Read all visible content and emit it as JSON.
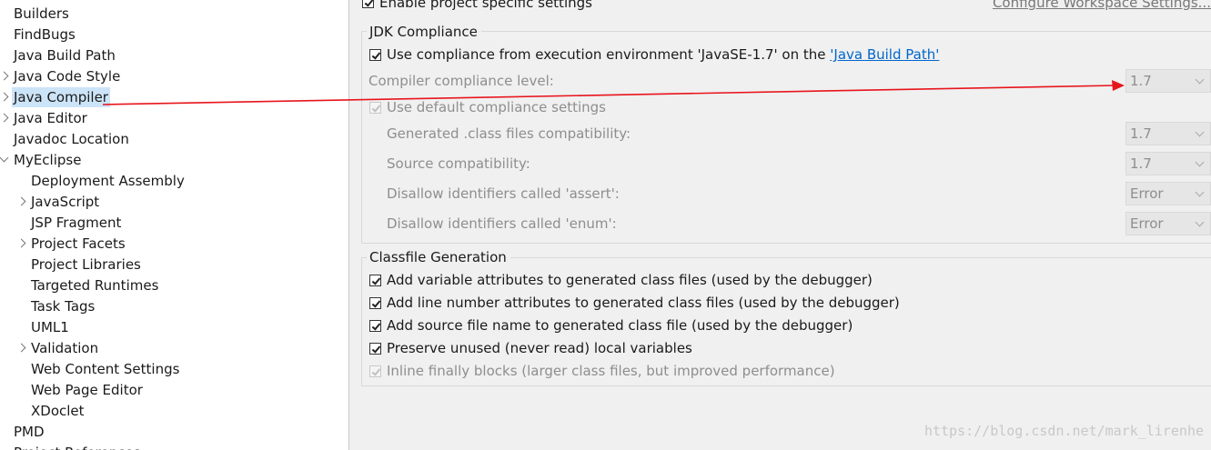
{
  "tree": [
    {
      "label": "Builders",
      "indent": 0,
      "expander": "none"
    },
    {
      "label": "FindBugs",
      "indent": 0,
      "expander": "none"
    },
    {
      "label": "Java Build Path",
      "indent": 0,
      "expander": "none"
    },
    {
      "label": "Java Code Style",
      "indent": 0,
      "expander": "collapsed"
    },
    {
      "label": "Java Compiler",
      "indent": 0,
      "expander": "collapsed",
      "selected": true
    },
    {
      "label": "Java Editor",
      "indent": 0,
      "expander": "collapsed"
    },
    {
      "label": "Javadoc Location",
      "indent": 0,
      "expander": "none"
    },
    {
      "label": "MyEclipse",
      "indent": 0,
      "expander": "expanded"
    },
    {
      "label": "Deployment Assembly",
      "indent": 1,
      "expander": "none"
    },
    {
      "label": "JavaScript",
      "indent": 1,
      "expander": "collapsed"
    },
    {
      "label": "JSP Fragment",
      "indent": 1,
      "expander": "none"
    },
    {
      "label": "Project Facets",
      "indent": 1,
      "expander": "collapsed"
    },
    {
      "label": "Project Libraries",
      "indent": 1,
      "expander": "none"
    },
    {
      "label": "Targeted Runtimes",
      "indent": 1,
      "expander": "none"
    },
    {
      "label": "Task Tags",
      "indent": 1,
      "expander": "none"
    },
    {
      "label": "UML1",
      "indent": 1,
      "expander": "none"
    },
    {
      "label": "Validation",
      "indent": 1,
      "expander": "collapsed"
    },
    {
      "label": "Web Content Settings",
      "indent": 1,
      "expander": "none"
    },
    {
      "label": "Web Page Editor",
      "indent": 1,
      "expander": "none"
    },
    {
      "label": "XDoclet",
      "indent": 1,
      "expander": "none"
    },
    {
      "label": "PMD",
      "indent": 0,
      "expander": "none"
    },
    {
      "label": "Project References",
      "indent": 0,
      "expander": "none"
    }
  ],
  "header": {
    "enable_label": "Enable project specific settings",
    "configure_link": "Configure Workspace Settings..."
  },
  "jdk": {
    "title": "JDK Compliance",
    "use_env_label": "Use compliance from execution environment 'JavaSE-1.7' on the ",
    "build_path_link": "'Java Build Path'",
    "level_label": "Compiler compliance level:",
    "level_value": "1.7",
    "use_default_label": "Use default compliance settings",
    "generated_label": "Generated .class files compatibility:",
    "generated_value": "1.7",
    "source_label": "Source compatibility:",
    "source_value": "1.7",
    "assert_label": "Disallow identifiers called 'assert':",
    "assert_value": "Error",
    "enum_label": "Disallow identifiers called 'enum':",
    "enum_value": "Error"
  },
  "classfile": {
    "title": "Classfile Generation",
    "items": [
      {
        "label": "Add variable attributes to generated class files (used by the debugger)",
        "checked": true,
        "disabled": false
      },
      {
        "label": "Add line number attributes to generated class files (used by the debugger)",
        "checked": true,
        "disabled": false
      },
      {
        "label": "Add source file name to generated class file (used by the debugger)",
        "checked": true,
        "disabled": false
      },
      {
        "label": "Preserve unused (never read) local variables",
        "checked": true,
        "disabled": false
      },
      {
        "label": "Inline finally blocks (larger class files, but improved performance)",
        "checked": true,
        "disabled": true
      }
    ]
  },
  "watermark": "https://blog.csdn.net/mark_lirenhe",
  "annotation_color": "#e8141c"
}
